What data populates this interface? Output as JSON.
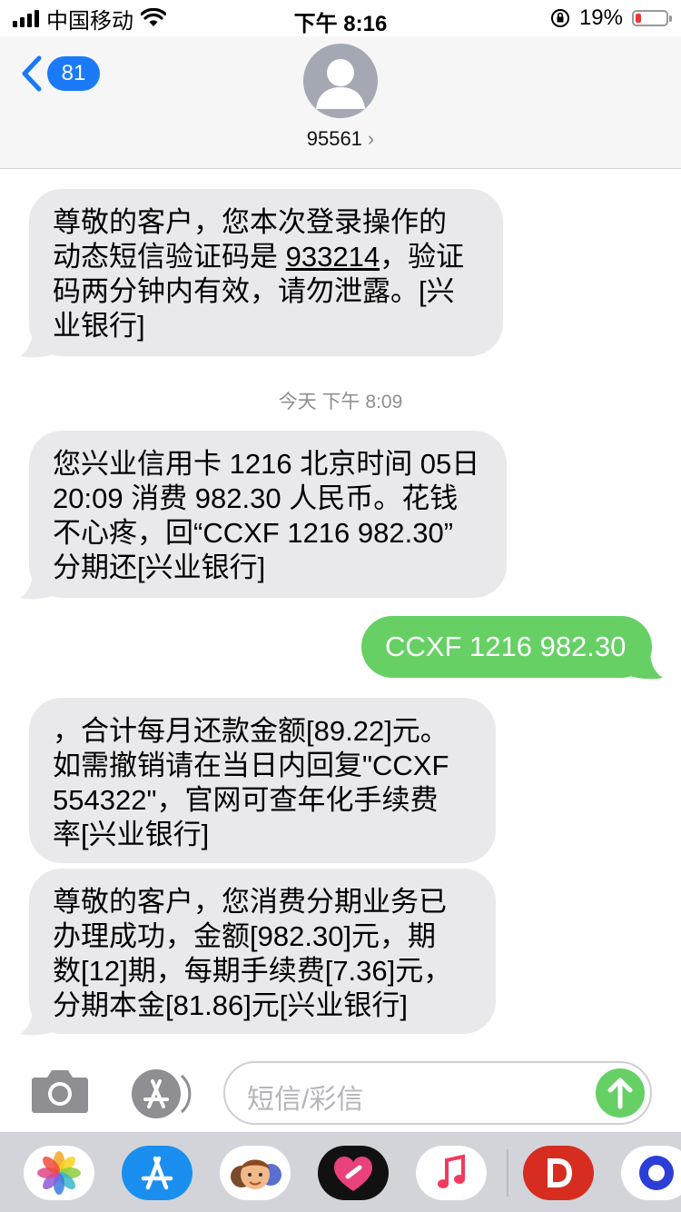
{
  "status_bar": {
    "carrier": "中国移动",
    "time": "下午 8:16",
    "battery": "19%",
    "battery_level": 0.19
  },
  "nav": {
    "unread_count": "81",
    "contact": "95561",
    "chevron": "›"
  },
  "messages": [
    {
      "from": "95561",
      "lines": [
        "尊敬的客户，您本次登录操作的",
        "动态短信验证码是 933214，验证",
        "码两分钟内有效，请勿泄露。[兴",
        "业银行]"
      ]
    },
    {
      "from": "95561",
      "lines": [
        "您兴业信用卡 1216 北京时间 05日",
        "20:09 消费 982.30 人民币。花钱",
        "不心疼，回“CCXF 1216 982.30”",
        "分期还[兴业银行]"
      ]
    },
    {
      "from": "me",
      "lines": [
        "CCXF 1216 982.30"
      ]
    },
    {
      "from": "95561",
      "lines": [
        "，合计每月还款金额[89.22]元。",
        "如需撤销请在当日内回复\"CCXF",
        "554322\"，官网可查年化手续费",
        "率[兴业银行]"
      ]
    },
    {
      "from": "95561",
      "lines": [
        "尊敬的客户，您消费分期业务已",
        "办理成功，金额[982.30]元，期",
        "数[12]期，每期手续费[7.36]元，",
        "分期本金[81.86]元[兴业银行]"
      ]
    }
  ],
  "msg1_pre": "动态短信验证码是 ",
  "msg1_code": "933214",
  "msg1_post": "，验证",
  "timestamp": "今天 下午 8:09",
  "composer": {
    "placeholder": "短信/彩信"
  },
  "dock_apps": [
    "photos-icon",
    "app-store-icon",
    "memoji-icon",
    "heart-app-icon",
    "music-icon",
    "d-app-icon",
    "circle-app-icon"
  ],
  "colors": {
    "accent": "#1a7af8",
    "bubble_out": "#66d065",
    "bubble_in": "#e9e9eb"
  }
}
